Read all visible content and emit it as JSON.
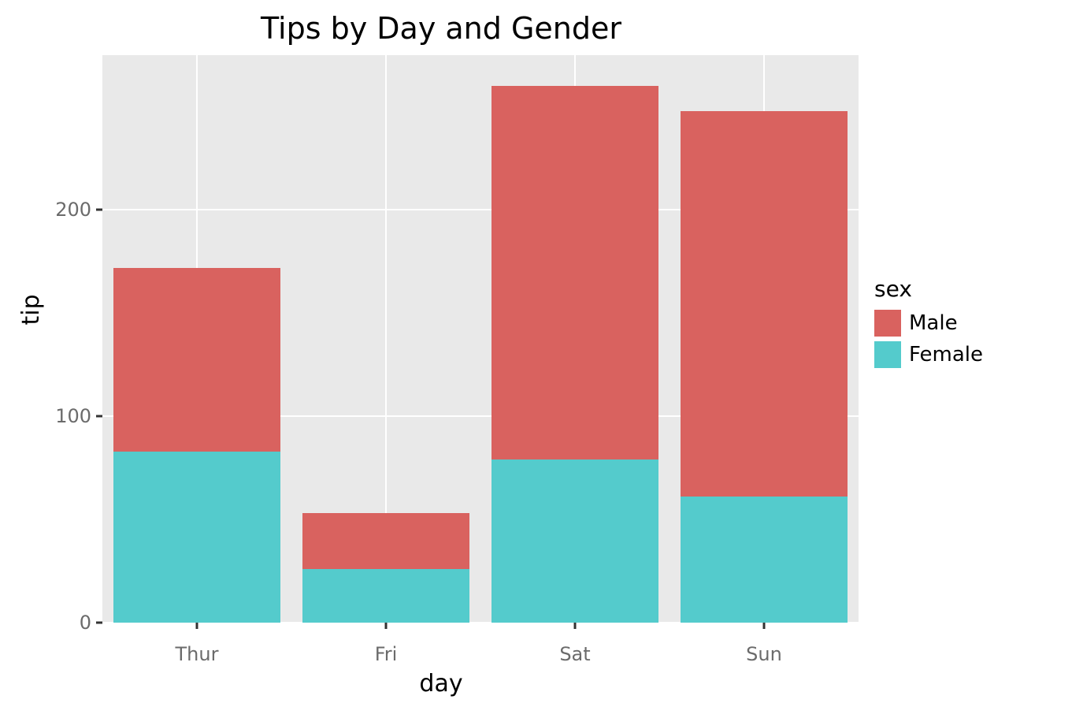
{
  "chart_data": {
    "type": "bar",
    "stacked": true,
    "title": "Tips by Day and Gender",
    "xlabel": "day",
    "ylabel": "tip",
    "categories": [
      "Thur",
      "Fri",
      "Sat",
      "Sun"
    ],
    "series": [
      {
        "name": "Male",
        "color": "#d9625f",
        "values": [
          89,
          27,
          181,
          187
        ]
      },
      {
        "name": "Female",
        "color": "#54cbcc",
        "values": [
          83,
          26,
          79,
          61
        ]
      }
    ],
    "xticks": [
      "Thur",
      "Fri",
      "Sat",
      "Sun"
    ],
    "yticks": [
      0,
      100,
      200
    ],
    "ylim": [
      0,
      275
    ],
    "legend_title": "sex",
    "legend_position": "right",
    "grid": true,
    "background": "#e9e9e9"
  }
}
